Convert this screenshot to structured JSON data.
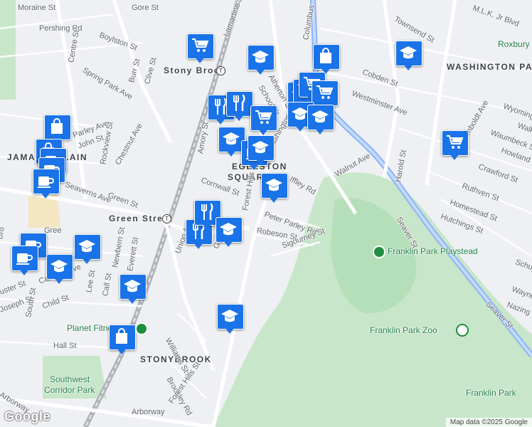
{
  "map": {
    "neighborhoods": [
      "JAMAICA PLAIN",
      "EGLESTON SQUARE",
      "WASHINGTON PARK",
      "STONYBROOK",
      "Roxbury"
    ],
    "parks": [
      "Franklin Park Playstead",
      "Franklin Park Zoo",
      "Franklin Park",
      "Southwest Corridor Park"
    ],
    "pois": [
      "Planet Fitness"
    ],
    "stations": [
      "Stony Brook",
      "Green Street"
    ],
    "streets": [
      "Moraine St",
      "Gore St",
      "Lamartine St",
      "Columbus",
      "M.L.K. Jr Blvd",
      "Townsend St",
      "Pershing Rd",
      "Boylston St",
      "Centre St",
      "Spring Park Ave",
      "Burr St",
      "Clive St",
      "Atherton St",
      "School St",
      "Cobden St",
      "Westminster Ave",
      "Parley Ave",
      "John St",
      "Chestnut Ave",
      "Rockview St",
      "Amory St",
      "Washington St",
      "Wyoming",
      "Humboldt Ave",
      "Waumbeck St",
      "Howland St",
      "Crawford St",
      "Walnut Ave",
      "Harold St",
      "Ruthven St",
      "Homestead St",
      "Hutchings St",
      "Seaver St",
      "Cornwall St",
      "Iffley Rd",
      "Seaverns Ave",
      "Green St",
      "Peter Parley Rd",
      "Robeson St",
      "Forest Hills St",
      "Sigourney St",
      "Union Ave",
      "Glen Rd",
      "Newbern St",
      "Everett St",
      "Call St",
      "Lee St",
      "Child St",
      "Joseph St",
      "South St",
      "Carolina Ave",
      "Gree",
      "Bro",
      "uster St",
      "Williams St",
      "Hall St",
      "Brookley Rd",
      "Arborway",
      "Wayne",
      "Nazing",
      "Schuy",
      "Walk"
    ],
    "attribution": "Map data ©2025 Google",
    "logo": "Google",
    "colors": {
      "marker": "#1a73e8",
      "park": "#c8e6c9",
      "road_main": "#ffffff",
      "highway": "#8ab4f8",
      "rail": "#9aa0a6"
    },
    "markers": [
      {
        "type": "shopping-cart"
      },
      {
        "type": "school"
      },
      {
        "type": "school"
      },
      {
        "type": "school"
      },
      {
        "type": "shopping-bag"
      },
      {
        "type": "shopping-cart"
      },
      {
        "type": "shopping-cart"
      },
      {
        "type": "shopping-cart"
      },
      {
        "type": "restaurant"
      },
      {
        "type": "restaurant"
      },
      {
        "type": "shopping-cart"
      },
      {
        "type": "school"
      },
      {
        "type": "school"
      },
      {
        "type": "school"
      },
      {
        "type": "coffee"
      },
      {
        "type": "school"
      },
      {
        "type": "shopping-cart"
      },
      {
        "type": "shopping-bag"
      },
      {
        "type": "shopping-bag"
      },
      {
        "type": "coffee"
      },
      {
        "type": "coffee"
      },
      {
        "type": "coffee"
      },
      {
        "type": "coffee"
      },
      {
        "type": "restaurant"
      },
      {
        "type": "restaurant"
      },
      {
        "type": "school"
      },
      {
        "type": "school"
      },
      {
        "type": "school"
      },
      {
        "type": "coffee"
      },
      {
        "type": "school"
      },
      {
        "type": "school"
      },
      {
        "type": "school"
      },
      {
        "type": "shopping-bag"
      }
    ]
  }
}
